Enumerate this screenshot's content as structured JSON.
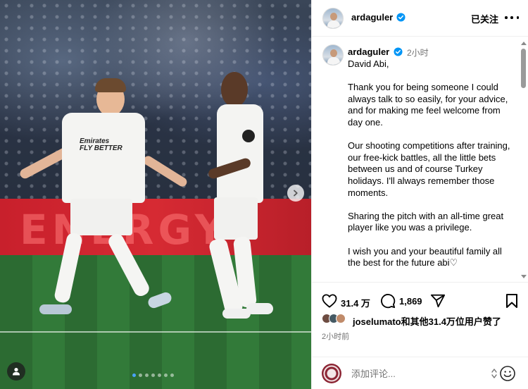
{
  "post": {
    "username": "ardaguler",
    "follow_status": "已关注",
    "time_ago": "2小时",
    "caption_paragraphs": [
      "David Abi,",
      "Thank you for being someone I could always talk to so easily, for your advice, and for making me feel welcome from day one.",
      "Our shooting competitions after training, our free-kick battles, all the little bets between us and of course Turkey holidays. I'll always remember those moments.",
      "Sharing the pitch with an all-time great player like you was a privilege.",
      "I wish you and your beautiful family all the best for the future abi♡"
    ],
    "likes_count": "31.4 万",
    "comments_count": "1,869",
    "liked_by_text": "joselumato和其他31.4万位用户赞了",
    "posted_time": "2小时前",
    "comment_placeholder": "添加评论..."
  },
  "media": {
    "banner_text": "ENERGY",
    "carousel_total": 7,
    "carousel_active": 1,
    "jersey_sponsor": "Emirates\nFLY BETTER"
  },
  "colors": {
    "verified_blue": "#0095f6",
    "secondary_text": "#737373",
    "divider": "#efefef"
  },
  "icons": {
    "like": "heart-icon",
    "comment": "comment-bubble-icon",
    "share": "paper-plane-icon",
    "save": "bookmark-icon",
    "more": "more-dots-icon",
    "verified": "verified-badge-icon",
    "emoji": "emoji-smile-icon",
    "next": "chevron-right-icon",
    "tag": "user-tag-icon"
  }
}
